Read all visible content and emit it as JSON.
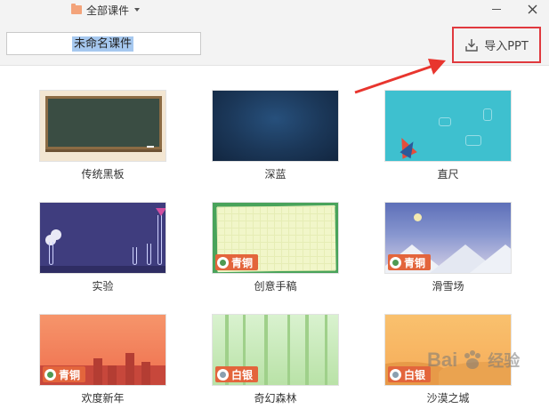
{
  "header": {
    "folder_label": "全部课件",
    "title_value": "未命名课件",
    "import_label": "导入PPT"
  },
  "templates": [
    {
      "label": "传统黑板"
    },
    {
      "label": "深蓝"
    },
    {
      "label": "直尺"
    },
    {
      "label": "实验"
    },
    {
      "label": "创意手稿",
      "badge": "青铜"
    },
    {
      "label": "滑雪场",
      "badge": "青铜"
    },
    {
      "label": "欢度新年",
      "badge": "青铜"
    },
    {
      "label": "奇幻森林",
      "badge": "白银"
    },
    {
      "label": "沙漠之城",
      "badge": "白银"
    }
  ],
  "watermark": {
    "brand": "Bai",
    "sub": "经验"
  },
  "colors": {
    "highlight_border": "#e0393e",
    "selection": "#a6c8ef",
    "badge_bg": "#e3653c"
  },
  "icons": [
    "folder-icon",
    "minimize-icon",
    "close-icon",
    "import-icon"
  ]
}
